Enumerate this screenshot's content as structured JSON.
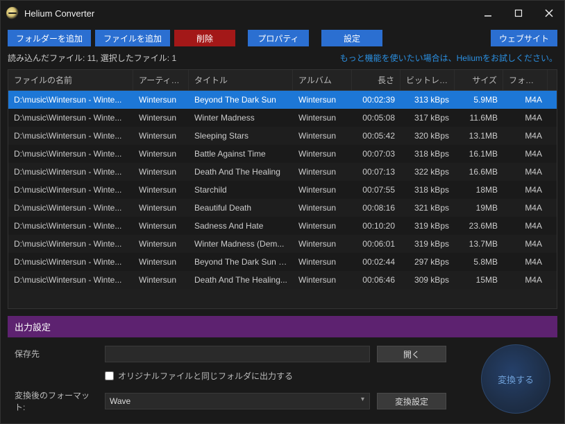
{
  "window": {
    "title": "Helium Converter"
  },
  "toolbar": {
    "add_folder": "フォルダーを追加",
    "add_file": "ファイルを追加",
    "delete": "削除",
    "properties": "プロパティ",
    "settings": "設定",
    "website": "ウェブサイト"
  },
  "status": {
    "text": "読み込んだファイル: 11, 選択したファイル: 1",
    "promo": "もっと機能を使いたい場合は、Heliumをお試しください。"
  },
  "columns": {
    "filename": "ファイルの名前",
    "artist": "アーティスト",
    "title": "タイトル",
    "album": "アルバム",
    "length": "長さ",
    "bitrate": "ビットレート",
    "size": "サイズ",
    "format": "フォーマット"
  },
  "rows": [
    {
      "selected": true,
      "filename": "D:\\music\\Wintersun - Winte...",
      "artist": "Wintersun",
      "title": "Beyond The Dark Sun",
      "album": "Wintersun",
      "length": "00:02:39",
      "bitrate": "313 kBps",
      "size": "5.9MB",
      "format": "M4A"
    },
    {
      "selected": false,
      "filename": "D:\\music\\Wintersun - Winte...",
      "artist": "Wintersun",
      "title": "Winter Madness",
      "album": "Wintersun",
      "length": "00:05:08",
      "bitrate": "317 kBps",
      "size": "11.6MB",
      "format": "M4A"
    },
    {
      "selected": false,
      "filename": "D:\\music\\Wintersun - Winte...",
      "artist": "Wintersun",
      "title": "Sleeping Stars",
      "album": "Wintersun",
      "length": "00:05:42",
      "bitrate": "320 kBps",
      "size": "13.1MB",
      "format": "M4A"
    },
    {
      "selected": false,
      "filename": "D:\\music\\Wintersun - Winte...",
      "artist": "Wintersun",
      "title": "Battle Against Time",
      "album": "Wintersun",
      "length": "00:07:03",
      "bitrate": "318 kBps",
      "size": "16.1MB",
      "format": "M4A"
    },
    {
      "selected": false,
      "filename": "D:\\music\\Wintersun - Winte...",
      "artist": "Wintersun",
      "title": "Death And The Healing",
      "album": "Wintersun",
      "length": "00:07:13",
      "bitrate": "322 kBps",
      "size": "16.6MB",
      "format": "M4A"
    },
    {
      "selected": false,
      "filename": "D:\\music\\Wintersun - Winte...",
      "artist": "Wintersun",
      "title": "Starchild",
      "album": "Wintersun",
      "length": "00:07:55",
      "bitrate": "318 kBps",
      "size": "18MB",
      "format": "M4A"
    },
    {
      "selected": false,
      "filename": "D:\\music\\Wintersun - Winte...",
      "artist": "Wintersun",
      "title": "Beautiful Death",
      "album": "Wintersun",
      "length": "00:08:16",
      "bitrate": "321 kBps",
      "size": "19MB",
      "format": "M4A"
    },
    {
      "selected": false,
      "filename": "D:\\music\\Wintersun - Winte...",
      "artist": "Wintersun",
      "title": "Sadness And Hate",
      "album": "Wintersun",
      "length": "00:10:20",
      "bitrate": "319 kBps",
      "size": "23.6MB",
      "format": "M4A"
    },
    {
      "selected": false,
      "filename": "D:\\music\\Wintersun - Winte...",
      "artist": "Wintersun",
      "title": "Winter Madness (Dem...",
      "album": "Wintersun",
      "length": "00:06:01",
      "bitrate": "319 kBps",
      "size": "13.7MB",
      "format": "M4A"
    },
    {
      "selected": false,
      "filename": "D:\\music\\Wintersun - Winte...",
      "artist": "Wintersun",
      "title": "Beyond The Dark Sun (...",
      "album": "Wintersun",
      "length": "00:02:44",
      "bitrate": "297 kBps",
      "size": "5.8MB",
      "format": "M4A"
    },
    {
      "selected": false,
      "filename": "D:\\music\\Wintersun - Winte...",
      "artist": "Wintersun",
      "title": "Death And The Healing...",
      "album": "Wintersun",
      "length": "00:06:46",
      "bitrate": "309 kBps",
      "size": "15MB",
      "format": "M4A"
    }
  ],
  "output": {
    "header": "出力設定",
    "save_to_label": "保存先",
    "save_to_value": "",
    "open_btn": "開く",
    "same_folder_checkbox": "オリジナルファイルと同じフォルダに出力する",
    "same_folder_checked": false,
    "format_label": "変換後のフォーマット:",
    "format_value": "Wave",
    "format_options": [
      "Wave"
    ],
    "convert_settings_btn": "変換設定",
    "convert_btn": "変換する"
  }
}
